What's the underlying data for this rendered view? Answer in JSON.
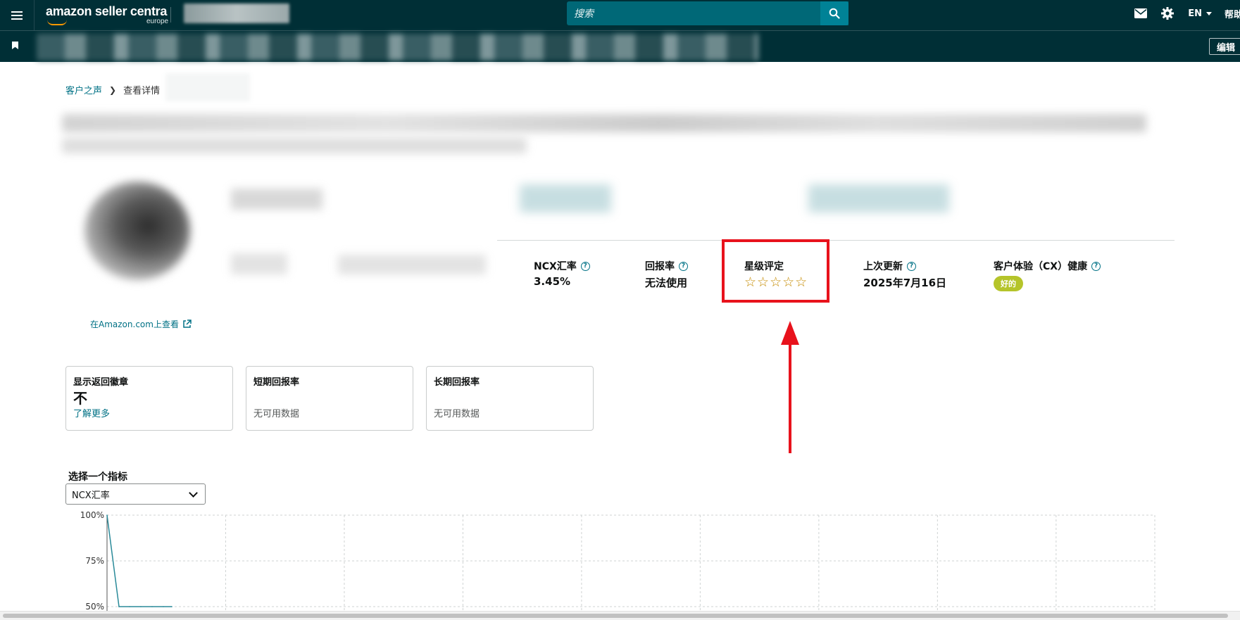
{
  "header": {
    "logo_text": "amazon seller centra",
    "logo_region": "europe",
    "search_placeholder": "搜索",
    "lang": "EN",
    "help": "帮助"
  },
  "navbar": {
    "edit_label": "编辑"
  },
  "breadcrumb": {
    "root": "客户之声",
    "current": "查看详情"
  },
  "product": {
    "view_link": "在Amazon.com上查看"
  },
  "metrics": [
    {
      "label": "NCX汇率",
      "value": "3.45%"
    },
    {
      "label": "回报率",
      "value": "无法使用"
    },
    {
      "label": "星级评定",
      "stars": "☆☆☆☆☆"
    },
    {
      "label": "上次更新",
      "value": "2025年7月16日"
    },
    {
      "label": "客户体验（CX）健康",
      "badge": "好的"
    }
  ],
  "cards": [
    {
      "title": "显示返回徽章",
      "value": "不",
      "link": "了解更多"
    },
    {
      "title": "短期回报率",
      "value": "无可用数据"
    },
    {
      "title": "长期回报率",
      "value": "无可用数据"
    }
  ],
  "metric_selector": {
    "label": "选择一个指标",
    "selected": "NCX汇率"
  },
  "chart_data": {
    "type": "line",
    "title": "",
    "xlabel": "",
    "ylabel": "",
    "y_tick_labels": [
      "100%",
      "75%",
      "50%"
    ],
    "ylim_visible": [
      50,
      100
    ],
    "grid": true,
    "series": [
      {
        "color": "#2a8a99",
        "values": [
          100,
          50,
          50,
          50,
          50,
          50,
          50
        ]
      }
    ]
  },
  "colors": {
    "header_bg": "#002f36",
    "search_bg": "#006877",
    "link": "#007185",
    "badge": "#b5c42a",
    "annotation": "#e8121c"
  }
}
